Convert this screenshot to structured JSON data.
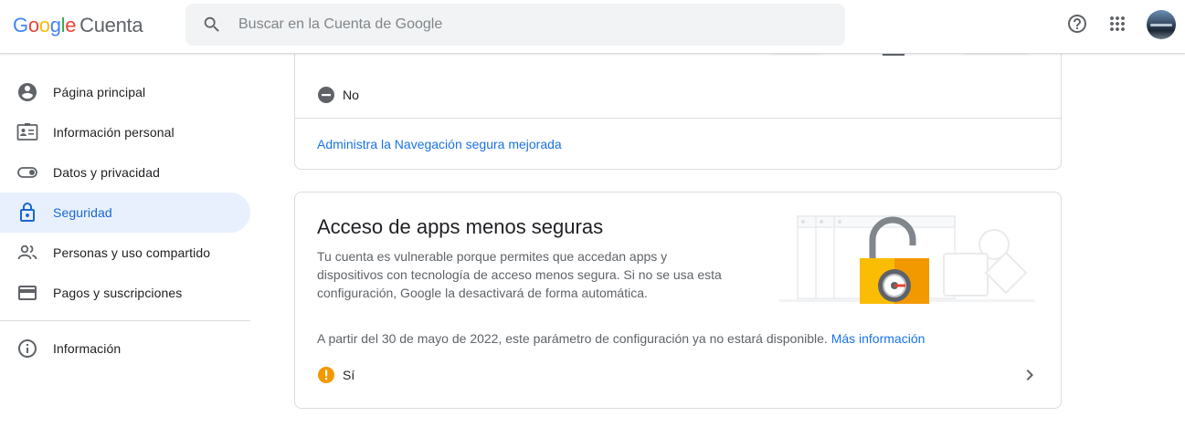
{
  "header": {
    "logo_google": "Google",
    "logo_product": "Cuenta",
    "search_placeholder": "Buscar en la Cuenta de Google"
  },
  "sidebar": {
    "items": [
      {
        "label": "Página principal",
        "icon": "account-circle-icon"
      },
      {
        "label": "Información personal",
        "icon": "id-card-icon"
      },
      {
        "label": "Datos y privacidad",
        "icon": "toggle-icon"
      },
      {
        "label": "Seguridad",
        "icon": "lock-icon",
        "active": true
      },
      {
        "label": "Personas y uso compartido",
        "icon": "people-icon"
      },
      {
        "label": "Pagos y suscripciones",
        "icon": "credit-card-icon"
      }
    ],
    "info_item": {
      "label": "Información",
      "icon": "info-icon"
    }
  },
  "safe_browsing_card": {
    "status_label": "No",
    "manage_link": "Administra la Navegación segura mejorada"
  },
  "less_secure_apps_card": {
    "title": "Acceso de apps menos seguras",
    "description": "Tu cuenta es vulnerable porque permites que accedan apps y dispositivos con tecnología de acceso menos segura. Si no se usa esta configuración, Google la desactivará de forma automática.",
    "notice": "A partir del 30 de mayo de 2022, este parámetro de configuración ya no estará disponible.",
    "notice_link": "Más información",
    "status_label": "Sí"
  },
  "colors": {
    "accent": "#1a73e8",
    "active_bg": "#e8f0fe",
    "warning": "#f29900",
    "lock_yellow": "#fbbc04"
  }
}
